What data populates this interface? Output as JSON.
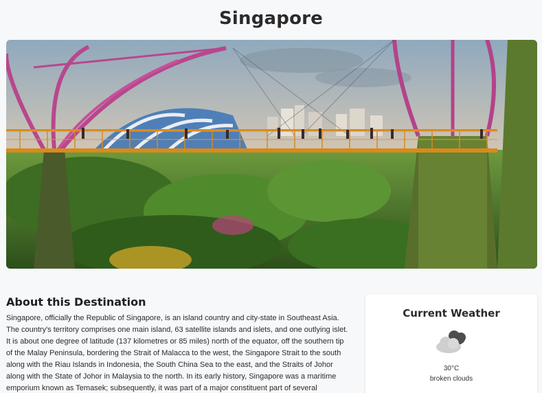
{
  "header": {
    "title": "Singapore"
  },
  "hero": {
    "image": "singapore-supertrees-skyway-icon"
  },
  "about": {
    "title": "About this Destination",
    "text": "Singapore, officially the Republic of Singapore, is an island country and city-state in Southeast Asia. The country's territory comprises one main island, 63 satellite islands and islets, and one outlying islet. It is about one degree of latitude (137 kilometres or 85 miles) north of the equator, off the southern tip of the Malay Peninsula, bordering the Strait of Malacca to the west, the Singapore Strait to the south along with the Riau Islands in Indonesia, the South China Sea to the east, and the Straits of Johor along with the State of Johor in Malaysia to the north. In its early history, Singapore was a maritime emporium known as Temasek; subsequently, it was part of a major constituent part of several successive thalassocratic empires. Its"
  },
  "weather": {
    "title": "Current Weather",
    "icon": "broken-clouds-icon",
    "temperature": "30°C",
    "description": "broken clouds"
  },
  "colors": {
    "background": "#f7f8fa",
    "card": "#ffffff",
    "title": "#2b2b2b"
  }
}
